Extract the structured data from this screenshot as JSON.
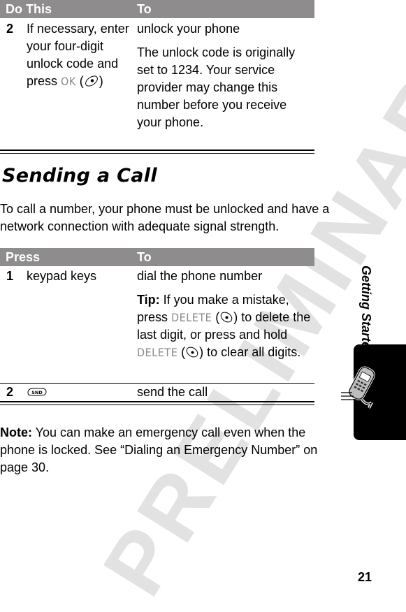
{
  "watermark": "PRELIMINARY",
  "table1": {
    "headers": [
      "Do This",
      "To"
    ],
    "rows": [
      {
        "step": "2",
        "action_parts": [
          "If necessary, enter your four-digit unlock code and press ",
          "OK",
          " (",
          ")"
        ],
        "action_icon": "center-select-key-icon",
        "result_paragraphs": [
          "unlock your phone",
          "The unlock code is originally set to 1234. Your service provider may change this number before you receive your phone."
        ]
      }
    ]
  },
  "section": {
    "title": "Sending a Call",
    "intro": "To call a number, your phone must be unlocked and have a network connection with adequate signal strength."
  },
  "table2": {
    "headers": [
      "Press",
      "To"
    ],
    "rows": [
      {
        "step": "1",
        "action": "keypad keys",
        "result": "dial the phone number",
        "tip": {
          "label": "Tip:",
          "parts": [
            " If you make a mistake, press ",
            "DELETE",
            " (",
            ") to delete the last digit, or press and hold ",
            "DELETE",
            " (",
            ") to clear all digits."
          ]
        }
      },
      {
        "step": "2",
        "action_icon": "send-key-icon",
        "action_icon_label": "SND",
        "result": "send the call"
      }
    ]
  },
  "note": {
    "label": "Note:",
    "text": " You can make an emergency call even when the phone is locked. See “Dialing an Emergency Number” on page 30."
  },
  "sidebar": {
    "chapter": "Getting Started"
  },
  "page_number": "21"
}
